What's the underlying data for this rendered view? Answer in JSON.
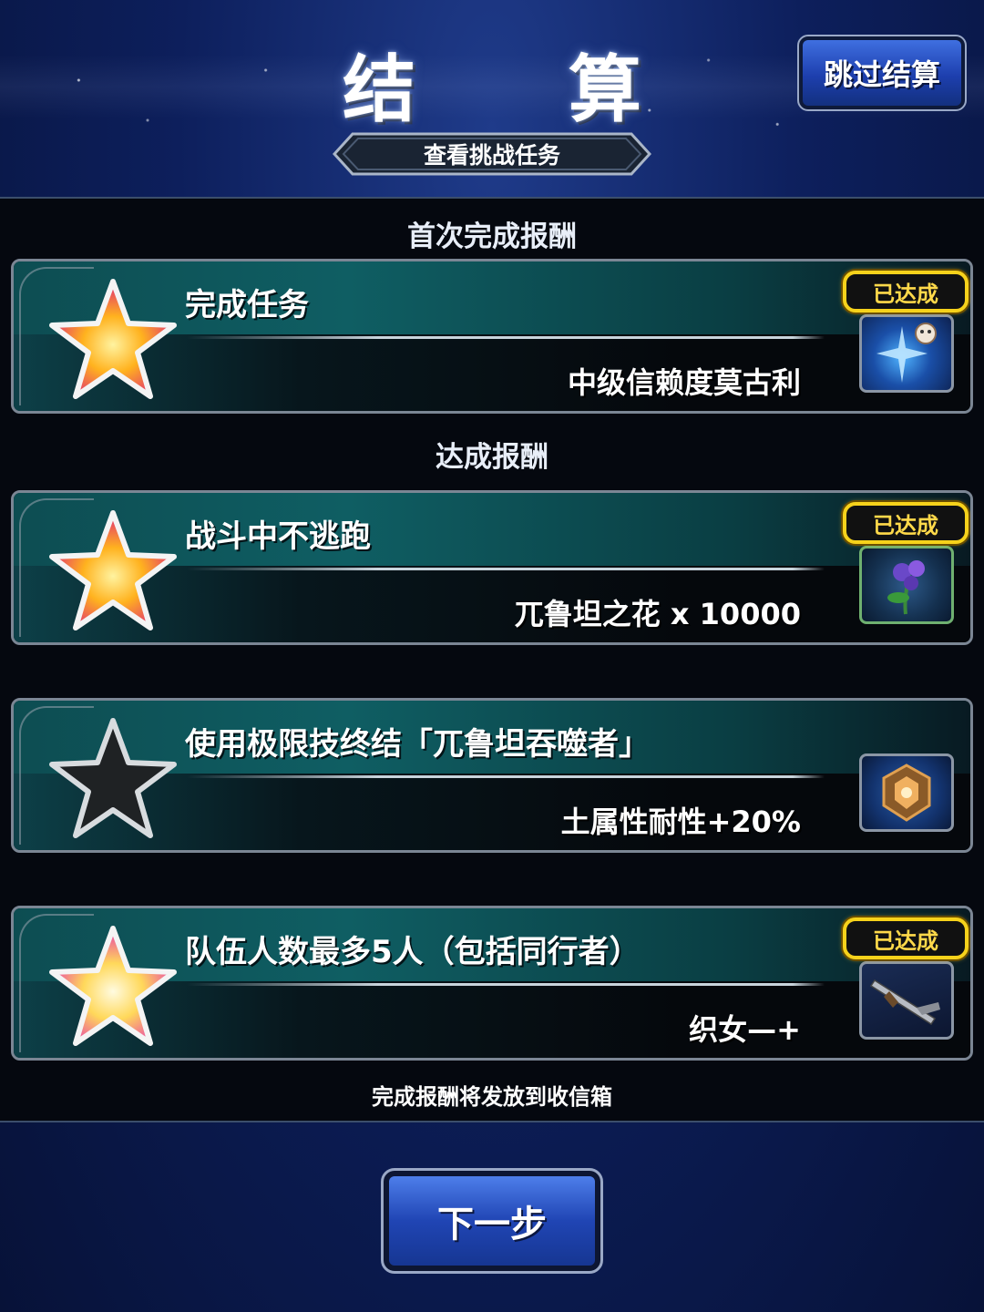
{
  "header": {
    "title": "结 算",
    "skip_label": "跳过结算",
    "challenge_label": "查看挑战任务"
  },
  "sections": {
    "first_clear": "首次完成报酬",
    "achievement": "达成报酬"
  },
  "missions": [
    {
      "name": "完成任务",
      "reward": "中级信赖度莫古利",
      "achieved": true,
      "badge": "已达成",
      "star": "gold",
      "icon": "moogle-crystal-icon"
    },
    {
      "name": "战斗中不逃跑",
      "reward": "兀鲁坦之花 x 10000",
      "achieved": true,
      "badge": "已达成",
      "star": "gold",
      "icon": "purple-flower-icon"
    },
    {
      "name": "使用极限技终结「兀鲁坦吞噬者」",
      "reward": "土属性耐性+20%",
      "achieved": false,
      "badge": "",
      "star": "dark",
      "icon": "earth-gem-icon"
    },
    {
      "name": "队伍人数最多5人（包括同行者）",
      "reward": "织女—+",
      "achieved": true,
      "badge": "已达成",
      "star": "gold",
      "icon": "gun-icon"
    }
  ],
  "footer": {
    "note": "完成报酬将发放到收信箱",
    "next_label": "下一步"
  },
  "colors": {
    "badge_border": "#f6d21b",
    "button_blue": "#2045b4",
    "card_teal": "#0f5e63"
  }
}
